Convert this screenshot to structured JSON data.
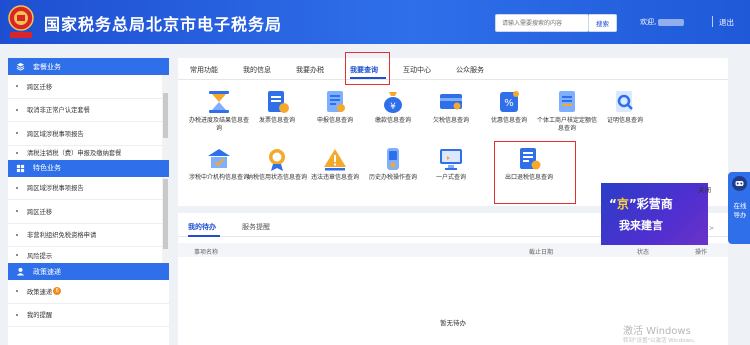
{
  "header": {
    "title": "国家税务总局北京市电子税务局",
    "search_placeholder": "请输入需要搜索的内容",
    "search_button": "搜索",
    "welcome": "欢迎,",
    "separator": "|",
    "logout": "退出",
    "brand_color": "#2f6fea"
  },
  "sidebar": {
    "sections": [
      {
        "title": "套餐业务",
        "icon": "package-icon",
        "items": [
          "跨区迁移",
          "取消非正常户认定套餐",
          "跨区域涉税事项报告",
          "清税注销税（费）申报及缴纳套餐"
        ]
      },
      {
        "title": "特色业务",
        "icon": "star-icon",
        "items": [
          "跨区域涉税事项报告",
          "跨区迁移",
          "非营利组织免税资格申请",
          "风险提示"
        ]
      },
      {
        "title": "政策速递",
        "icon": "user-icon",
        "items": [
          "政策速递",
          "我的提醒"
        ],
        "badge": "6"
      }
    ]
  },
  "main": {
    "tabs": [
      "常用功能",
      "我的信息",
      "我要办税",
      "我要查询",
      "互动中心",
      "公众服务"
    ],
    "active_tab": "我要查询",
    "items_row1": [
      {
        "label": "办税进度及结果信息查询",
        "icon": "hourglass-icon"
      },
      {
        "label": "发票信息查询",
        "icon": "invoice-icon"
      },
      {
        "label": "申报信息查询",
        "icon": "declaration-icon"
      },
      {
        "label": "缴款信息查询",
        "icon": "money-bag-icon"
      },
      {
        "label": "欠税信息查询",
        "icon": "card-icon"
      },
      {
        "label": "优惠信息查询",
        "icon": "discount-icon"
      },
      {
        "label": "个体工商户核定定额信息查询",
        "icon": "document-icon"
      },
      {
        "label": "证明信息查询",
        "icon": "search-certificate-icon"
      }
    ],
    "items_row2": [
      {
        "label": "涉税中介机构信息查询",
        "icon": "agency-icon"
      },
      {
        "label": "纳税信用状态信息查询",
        "icon": "credit-medal-icon"
      },
      {
        "label": "违法违章信息查询",
        "icon": "warning-icon"
      },
      {
        "label": "历史办税操作查询",
        "icon": "history-icon"
      },
      {
        "label": "一户式查询",
        "icon": "monitor-icon"
      },
      {
        "label": "出口退税信息查询",
        "icon": "export-refund-icon"
      }
    ]
  },
  "todo": {
    "tabs": [
      "我的待办",
      "服务提醒"
    ],
    "more": "更多 >",
    "columns": [
      "事项名称",
      "截止日期",
      "状态",
      "操作"
    ],
    "empty_text": "暂无待办"
  },
  "ad": {
    "line1_quote_open": "“",
    "line1_highlight": "京",
    "line1_quote_close": "”",
    "line1_rest": "彩营商",
    "line2": "我来建言",
    "close": "关闭"
  },
  "float_service": {
    "text": "在线导办"
  },
  "watermark": {
    "line1": "激活 Windows",
    "line2": "转到\"设置\"以激活 Windows。"
  }
}
